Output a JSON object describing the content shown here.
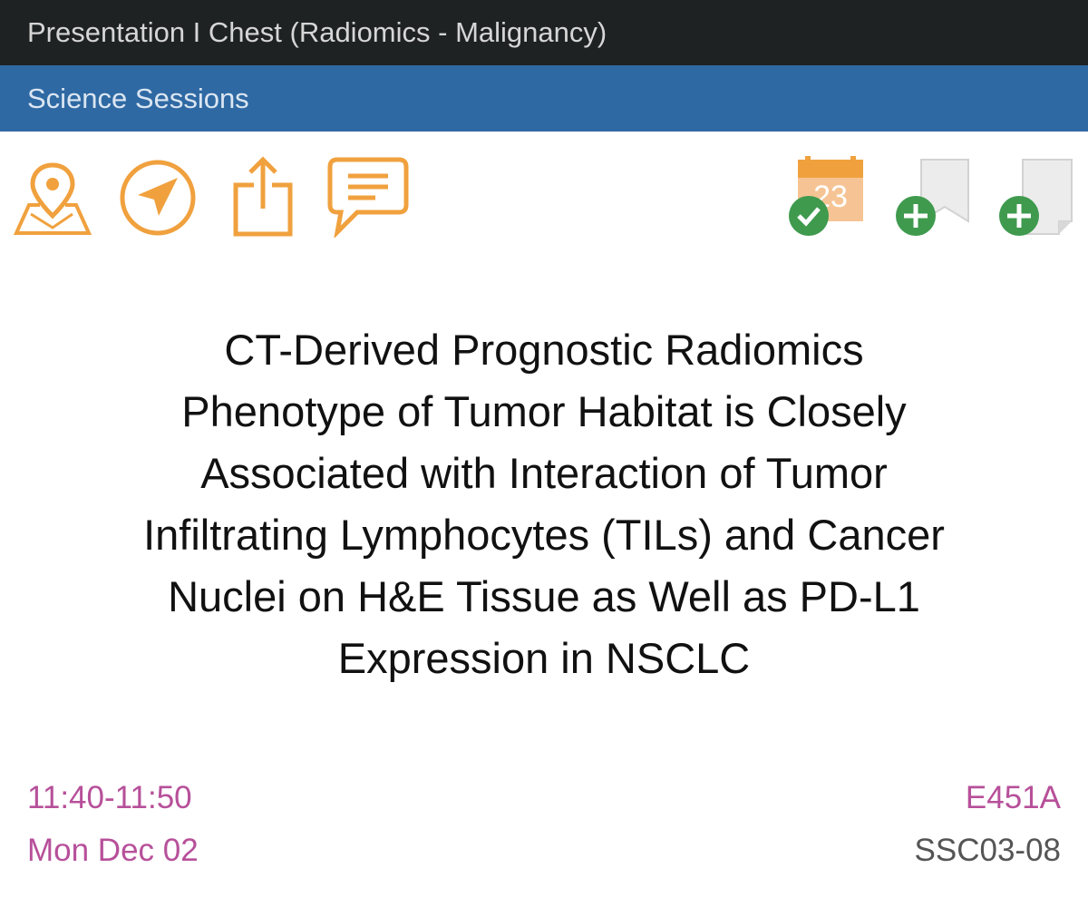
{
  "header": {
    "title": "Presentation I Chest (Radiomics - Malignancy)"
  },
  "subheader": {
    "section": "Science Sessions"
  },
  "toolbar": {
    "left_icons": [
      "map-pin-icon",
      "navigate-icon",
      "share-icon",
      "comment-icon"
    ],
    "right_icons": [
      "calendar-added-icon",
      "add-bookmark-icon",
      "add-note-icon"
    ],
    "calendar_day": "23",
    "colors": {
      "accent": "#f0a13e",
      "added_green": "#3f9a4e",
      "header_dark": "#1f2223",
      "header_blue": "#2f69a3"
    }
  },
  "presentation": {
    "title_lines": [
      "CT-Derived Prognostic Radiomics",
      "Phenotype of Tumor Habitat is Closely",
      "Associated with Interaction of Tumor",
      "Infiltrating Lymphocytes (TILs) and Cancer",
      "Nuclei on H&E Tissue as Well as PD-L1",
      "Expression in NSCLC"
    ],
    "time": "11:40-11:50",
    "date": "Mon Dec 02",
    "room": "E451A",
    "code": "SSC03-08"
  }
}
